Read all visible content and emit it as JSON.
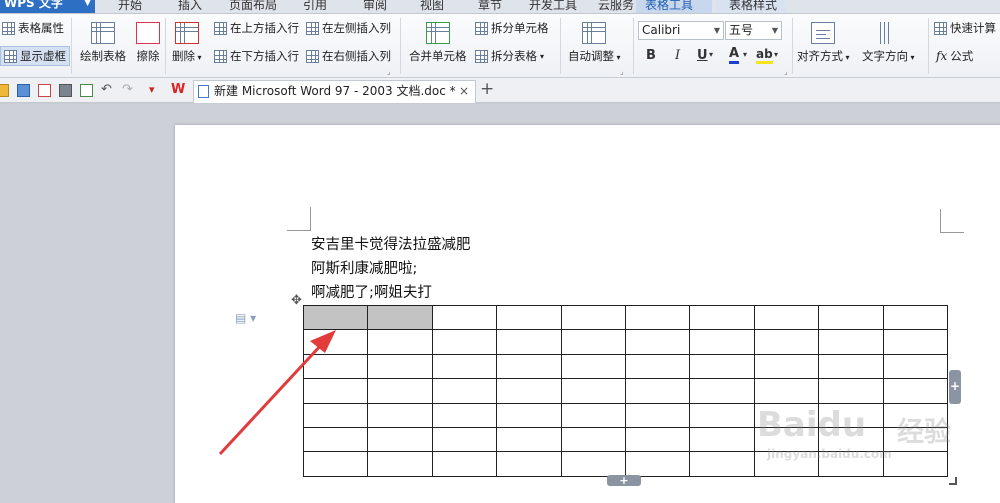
{
  "app": {
    "name": "WPS 文字"
  },
  "menu": {
    "tabs": [
      "开始",
      "插入",
      "页面布局",
      "引用",
      "审阅",
      "视图",
      "章节",
      "开发工具",
      "云服务",
      "表格工具",
      "表格样式"
    ],
    "active": "表格工具"
  },
  "ribbon": {
    "table_properties": "表格属性",
    "show_gridlines": "显示虚框",
    "draw_table": "绘制表格",
    "eraser": "擦除",
    "delete": "删除",
    "insert_row_above": "在上方插入行",
    "insert_row_below": "在下方插入行",
    "insert_col_left": "在左侧插入列",
    "insert_col_right": "在右侧插入列",
    "merge_cells": "合并单元格",
    "split_cells": "拆分单元格",
    "split_table": "拆分表格",
    "autofit": "自动调整",
    "font_name": "Calibri",
    "font_size": "五号",
    "bold": "B",
    "italic": "I",
    "underline": "U",
    "font_color": "A",
    "highlight": "ab",
    "align": "对齐方式",
    "text_direction": "文字方向",
    "quick_calc": "快速计算",
    "formula": "公式",
    "formula_prefix": "fx"
  },
  "doc_tab": {
    "title": "新建 Microsoft Word 97 - 2003 文档.doc *",
    "close": "×",
    "new": "+"
  },
  "document": {
    "lines": [
      "安吉里卡觉得法拉盛减肥",
      "阿斯利康减肥啦;",
      "啊减肥了;啊姐夫打"
    ],
    "table": {
      "rows": 7,
      "cols": 10,
      "selected": [
        [
          0,
          0
        ],
        [
          0,
          1
        ]
      ]
    }
  },
  "watermark": {
    "brand": "Baidu",
    "cn": "经验",
    "url": "jingyan.baidu.com"
  },
  "colors": {
    "accent": "#2d6fc3",
    "arrow": "#e23b3b",
    "selected_cell": "#c3c3c3"
  }
}
